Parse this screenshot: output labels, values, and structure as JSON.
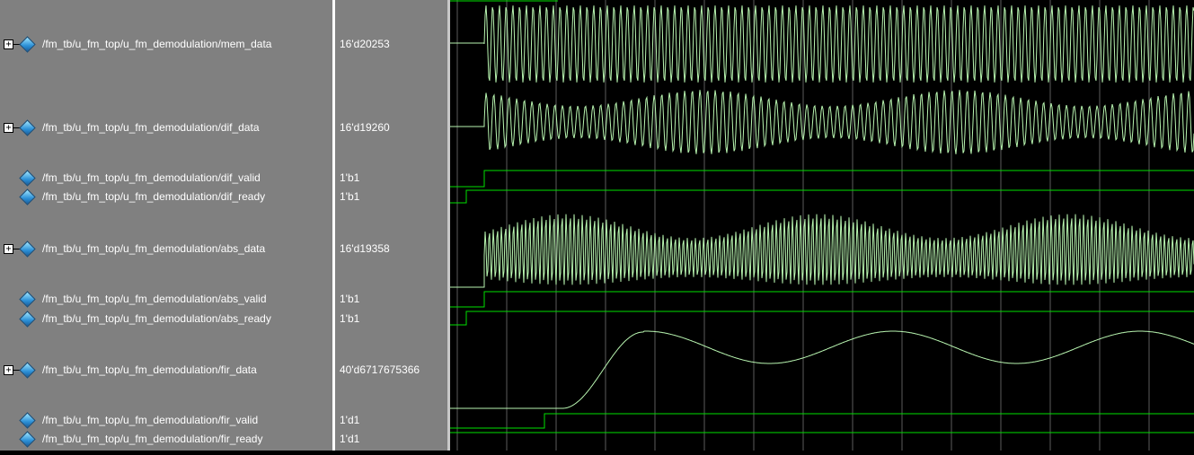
{
  "signals": [
    {
      "name": "/fm_tb/u_fm_top/u_fm_demodulation/mem_data",
      "value": "16'd20253",
      "expandable": true
    },
    {
      "name": "/fm_tb/u_fm_top/u_fm_demodulation/dif_data",
      "value": "16'd19260",
      "expandable": true
    },
    {
      "name": "/fm_tb/u_fm_top/u_fm_demodulation/dif_valid",
      "value": "1'b1",
      "expandable": false
    },
    {
      "name": "/fm_tb/u_fm_top/u_fm_demodulation/dif_ready",
      "value": "1'b1",
      "expandable": false
    },
    {
      "name": "/fm_tb/u_fm_top/u_fm_demodulation/abs_data",
      "value": "16'd19358",
      "expandable": true
    },
    {
      "name": "/fm_tb/u_fm_top/u_fm_demodulation/abs_valid",
      "value": "1'b1",
      "expandable": false
    },
    {
      "name": "/fm_tb/u_fm_top/u_fm_demodulation/abs_ready",
      "value": "1'b1",
      "expandable": false
    },
    {
      "name": "/fm_tb/u_fm_top/u_fm_demodulation/fir_data",
      "value": "40'd6717675366",
      "expandable": true
    },
    {
      "name": "/fm_tb/u_fm_top/u_fm_demodulation/fir_valid",
      "value": "1'd1",
      "expandable": false
    },
    {
      "name": "/fm_tb/u_fm_top/u_fm_demodulation/fir_ready",
      "value": "1'd1",
      "expandable": false
    }
  ],
  "expand_glyph": "+",
  "colors": {
    "pane_bg": "#808080",
    "wave_bg": "#000000",
    "wave_analog": "#b8f5b0",
    "wave_digital": "#00e000",
    "grid": "#cfcfcf"
  }
}
